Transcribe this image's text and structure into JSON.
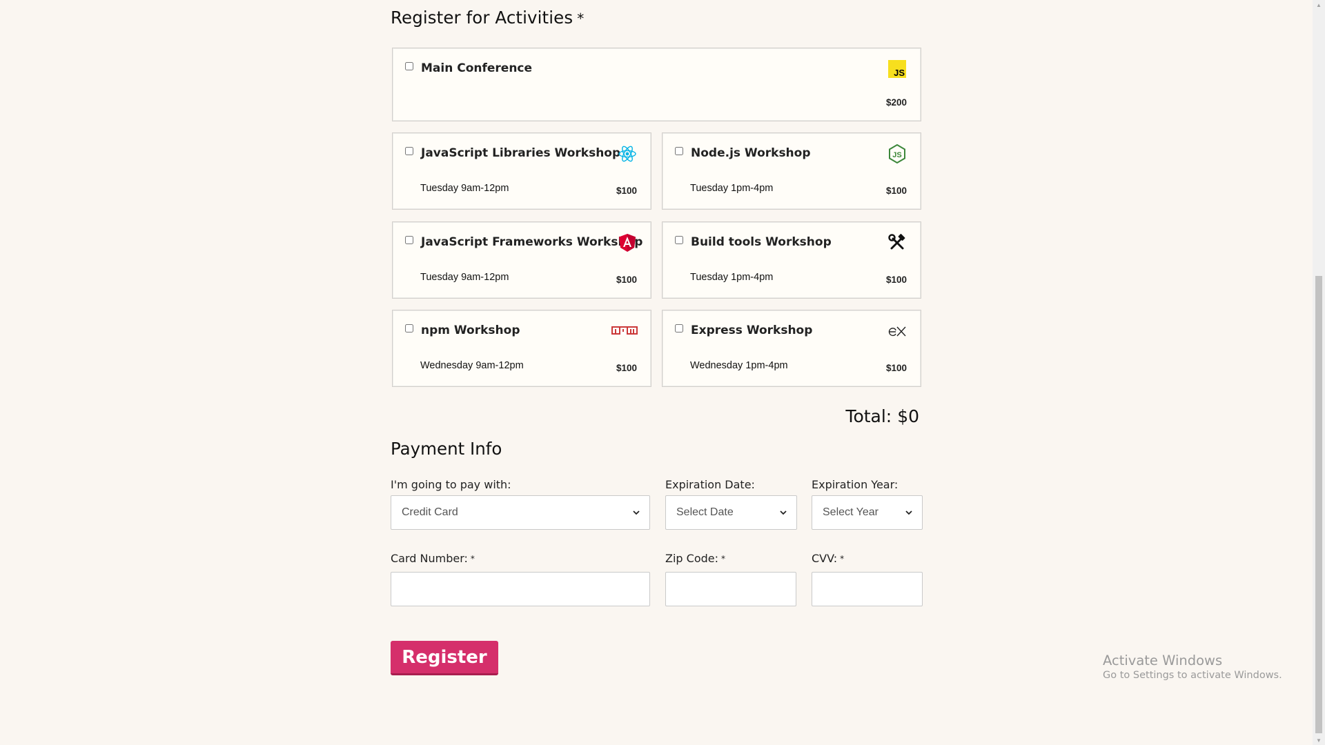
{
  "activities": {
    "heading": "Register for Activities",
    "required_marker": "*",
    "items": [
      {
        "title": "Main Conference",
        "time": "",
        "price": "$200",
        "icon": "javascript-icon"
      },
      {
        "title": "JavaScript Libraries Workshop",
        "time": "Tuesday 9am-12pm",
        "price": "$100",
        "icon": "react-icon"
      },
      {
        "title": "Node.js Workshop",
        "time": "Tuesday 1pm-4pm",
        "price": "$100",
        "icon": "nodejs-icon"
      },
      {
        "title": "JavaScript Frameworks Workshop",
        "time": "Tuesday 9am-12pm",
        "price": "$100",
        "icon": "angular-icon"
      },
      {
        "title": "Build tools Workshop",
        "time": "Tuesday 1pm-4pm",
        "price": "$100",
        "icon": "hammer-wrench-icon"
      },
      {
        "title": "npm Workshop",
        "time": "Wednesday 9am-12pm",
        "price": "$100",
        "icon": "npm-icon"
      },
      {
        "title": "Express Workshop",
        "time": "Wednesday 1pm-4pm",
        "price": "$100",
        "icon": "express-icon"
      }
    ],
    "total_label": "Total:",
    "total_value": "$0"
  },
  "payment": {
    "heading": "Payment Info",
    "method_label": "I'm going to pay with:",
    "method_value": "Credit Card",
    "exp_date_label": "Expiration Date:",
    "exp_date_value": "Select Date",
    "exp_year_label": "Expiration Year:",
    "exp_year_value": "Select Year",
    "card_number_label": "Card Number:",
    "zip_label": "Zip Code:",
    "cvv_label": "CVV:",
    "required_marker": "*",
    "card_number_value": "",
    "zip_value": "",
    "cvv_value": ""
  },
  "register_label": "Register",
  "watermark": {
    "line1": "Activate Windows",
    "line2": "Go to Settings to activate Windows."
  },
  "colors": {
    "background": "#faf6f1",
    "register_button": "#d52f6b",
    "js_logo": "#f7df1e",
    "react_logo": "#00b3e6",
    "node_logo": "#3c873a",
    "angular_logo": "#dd0031",
    "npm_logo": "#cb3837"
  }
}
